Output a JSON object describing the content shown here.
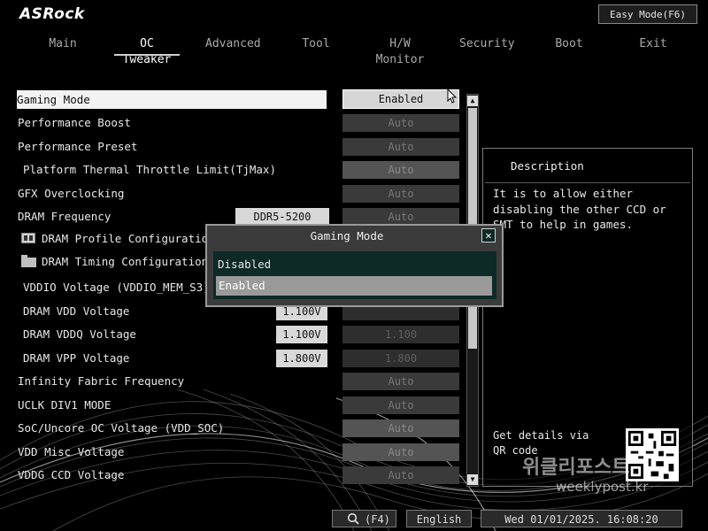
{
  "brand": "ASRock",
  "easy_mode_label": "Easy Mode(F6)",
  "tabs": [
    {
      "label": "Main"
    },
    {
      "label": "OC Tweaker"
    },
    {
      "label": "Advanced"
    },
    {
      "label": "Tool"
    },
    {
      "label": "H/W Monitor"
    },
    {
      "label": "Security"
    },
    {
      "label": "Boot"
    },
    {
      "label": "Exit"
    }
  ],
  "active_tab": "OC Tweaker",
  "settings": [
    {
      "label": "Gaming Mode",
      "value": "Enabled"
    },
    {
      "label": "Performance Boost",
      "value": "Auto"
    },
    {
      "label": "Performance Preset",
      "value": "Auto"
    },
    {
      "label": "Platform Thermal Throttle Limit(TjMax)",
      "value": "Auto"
    },
    {
      "label": "GFX Overclocking",
      "value": "Auto"
    },
    {
      "label": "DRAM Frequency",
      "current": "DDR5-5200",
      "value": "Auto"
    },
    {
      "label": "DRAM Profile Configuration"
    },
    {
      "label": "DRAM Timing Configuration"
    },
    {
      "label": "VDDIO Voltage (VDDIO_MEM_S3)"
    },
    {
      "label": "DRAM VDD Voltage",
      "current": "1.100V"
    },
    {
      "label": "DRAM VDDQ Voltage",
      "current": "1.100V",
      "value": "1.100"
    },
    {
      "label": "DRAM VPP Voltage",
      "current": "1.800V",
      "value": "1.800"
    },
    {
      "label": "Infinity Fabric Frequency",
      "value": "Auto"
    },
    {
      "label": "UCLK DIV1 MODE",
      "value": "Auto"
    },
    {
      "label": "SoC/Uncore OC Voltage (VDD_SOC)",
      "value": "Auto"
    },
    {
      "label": "VDD Misc Voltage",
      "value": "Auto"
    },
    {
      "label": "VDDG CCD Voltage",
      "value": "Auto"
    }
  ],
  "description": {
    "title": "Description",
    "text": "It is to allow either disabling the other CCD or SMT to help in games.",
    "qr_text": "Get details via QR code"
  },
  "modal": {
    "title": "Gaming Mode",
    "close_icon": "close-icon",
    "options": [
      "Disabled",
      "Enabled"
    ],
    "selected": "Enabled"
  },
  "footer": {
    "search_label": "(F4)",
    "language": "English",
    "datetime": "Wed 01/01/2025. 16:08:20"
  },
  "watermark": {
    "line1": "위클리포스트",
    "line2": "weeklypost.kr"
  },
  "colors": {
    "modal_list_bg": "#0d2a27",
    "selected_row_bg": "#f2f2f2",
    "dim_value_bg": "#3a3a3a"
  }
}
